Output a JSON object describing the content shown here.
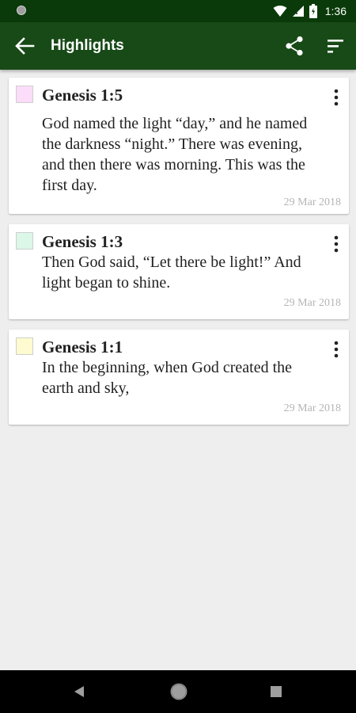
{
  "status_bar": {
    "time": "1:36"
  },
  "app_bar": {
    "title": "Highlights"
  },
  "icons": {
    "back": "arrow-left-icon",
    "share": "share-icon",
    "sort": "sort-icon",
    "more": "more-vertical-icon"
  },
  "highlights": [
    {
      "reference": "Genesis 1:5",
      "text": "God named the light “day,” and he named the darkness “night.” There was evening, and then there was morning. This was the first day.",
      "date": "29 Mar 2018",
      "color": "#fbdcf9"
    },
    {
      "reference": "Genesis 1:3",
      "text": "Then God said, “Let there be light!” And light began to shine.",
      "date": "29 Mar 2018",
      "color": "#dcf7e8"
    },
    {
      "reference": "Genesis 1:1",
      "text": "In the beginning, when God created the earth and sky,",
      "date": "29 Mar 2018",
      "color": "#fdfbcf"
    }
  ],
  "colors": {
    "status_bar": "#0a3a0a",
    "app_bar": "#174a17",
    "background": "#eeeeee"
  }
}
